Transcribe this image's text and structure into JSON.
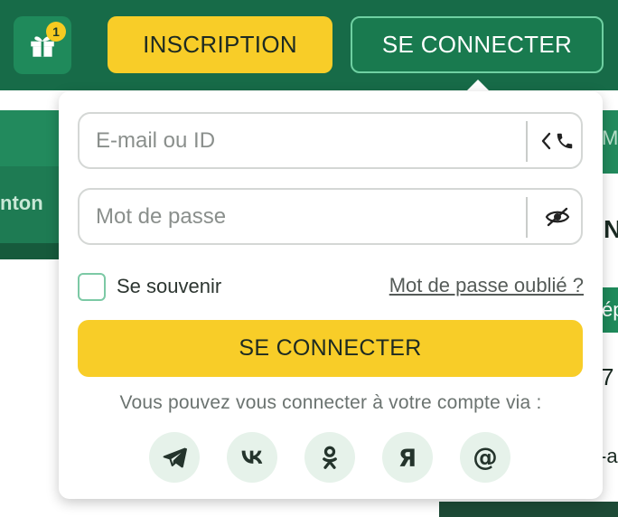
{
  "header": {
    "gift_badge": "1",
    "register_label": "INSCRIPTION",
    "login_label": "SE CONNECTER"
  },
  "background": {
    "left_text": "nton",
    "right_text_top": "Ma",
    "right_heading": "N",
    "right_text_mid": "ép",
    "right_number": "7",
    "right_text_bottom": "-a"
  },
  "login_form": {
    "email_placeholder": "E-mail ou ID",
    "password_placeholder": "Mot de passe",
    "remember_label": "Se souvenir",
    "forgot_label": "Mot de passe oublié ?",
    "submit_label": "SE CONNECTER",
    "via_text": "Vous pouvez vous connecter à votre compte via :",
    "socials": [
      {
        "name": "telegram-icon"
      },
      {
        "name": "vk-icon"
      },
      {
        "name": "odnoklassniki-icon"
      },
      {
        "name": "yandex-icon"
      },
      {
        "name": "mail-icon"
      }
    ]
  },
  "colors": {
    "header_green": "#176b48",
    "accent_yellow": "#f8cd28",
    "login_button_green": "#197a4f",
    "social_bg": "#e6f2ea"
  }
}
